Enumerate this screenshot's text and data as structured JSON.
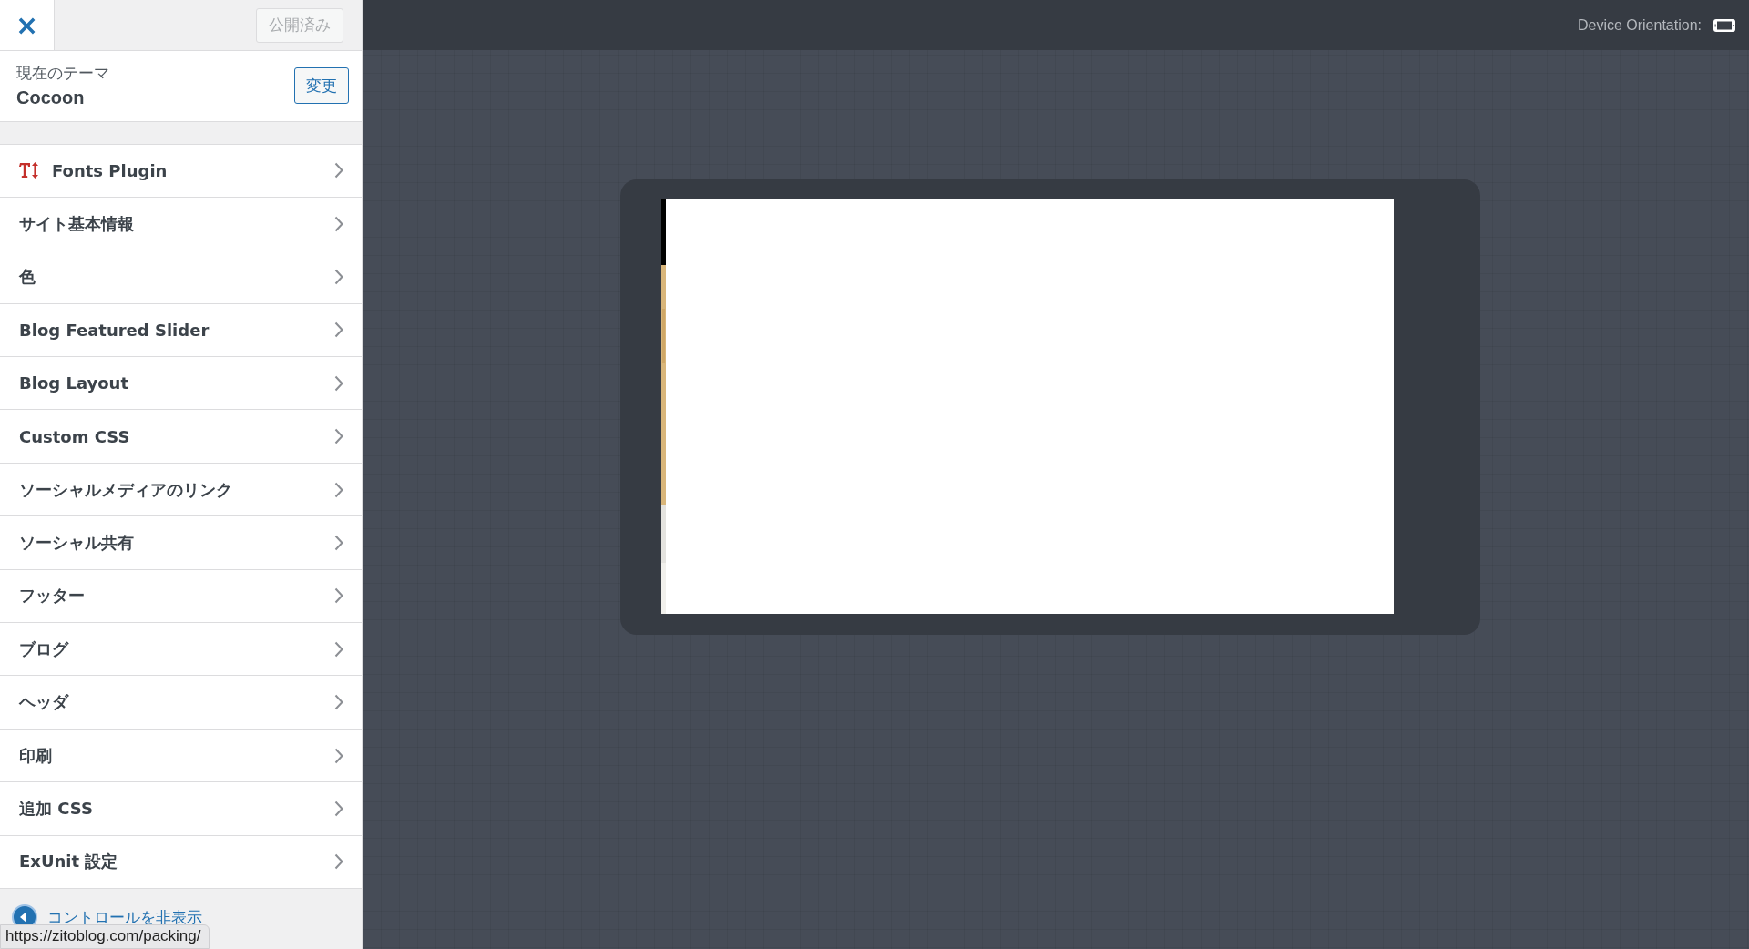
{
  "header": {
    "close_label": "×",
    "publish_button": {
      "label": "公開済み",
      "disabled": true
    }
  },
  "theme": {
    "caption": "現在のテーマ",
    "name": "Cocoon",
    "change_button": "変更"
  },
  "sections": [
    {
      "label": "Fonts Plugin",
      "kind": "plugin"
    },
    {
      "label": "サイト基本情報",
      "kind": "section"
    },
    {
      "label": "色",
      "kind": "section"
    },
    {
      "label": "Blog Featured Slider",
      "kind": "section"
    },
    {
      "label": "Blog Layout",
      "kind": "section"
    },
    {
      "label": "Custom CSS",
      "kind": "section"
    },
    {
      "label": "ソーシャルメディアのリンク",
      "kind": "section"
    },
    {
      "label": "ソーシャル共有",
      "kind": "section"
    },
    {
      "label": "フッター",
      "kind": "section"
    },
    {
      "label": "ブログ",
      "kind": "section"
    },
    {
      "label": "ヘッダ",
      "kind": "section"
    },
    {
      "label": "印刷",
      "kind": "section"
    },
    {
      "label": "追加 CSS",
      "kind": "section"
    },
    {
      "label": "ExUnit 設定",
      "kind": "section"
    }
  ],
  "footer": {
    "hide_controls": "コントロールを非表示"
  },
  "status_url": "https://zitoblog.com/packing/",
  "preview": {
    "device_orientation_label": "Device Orientation:"
  }
}
